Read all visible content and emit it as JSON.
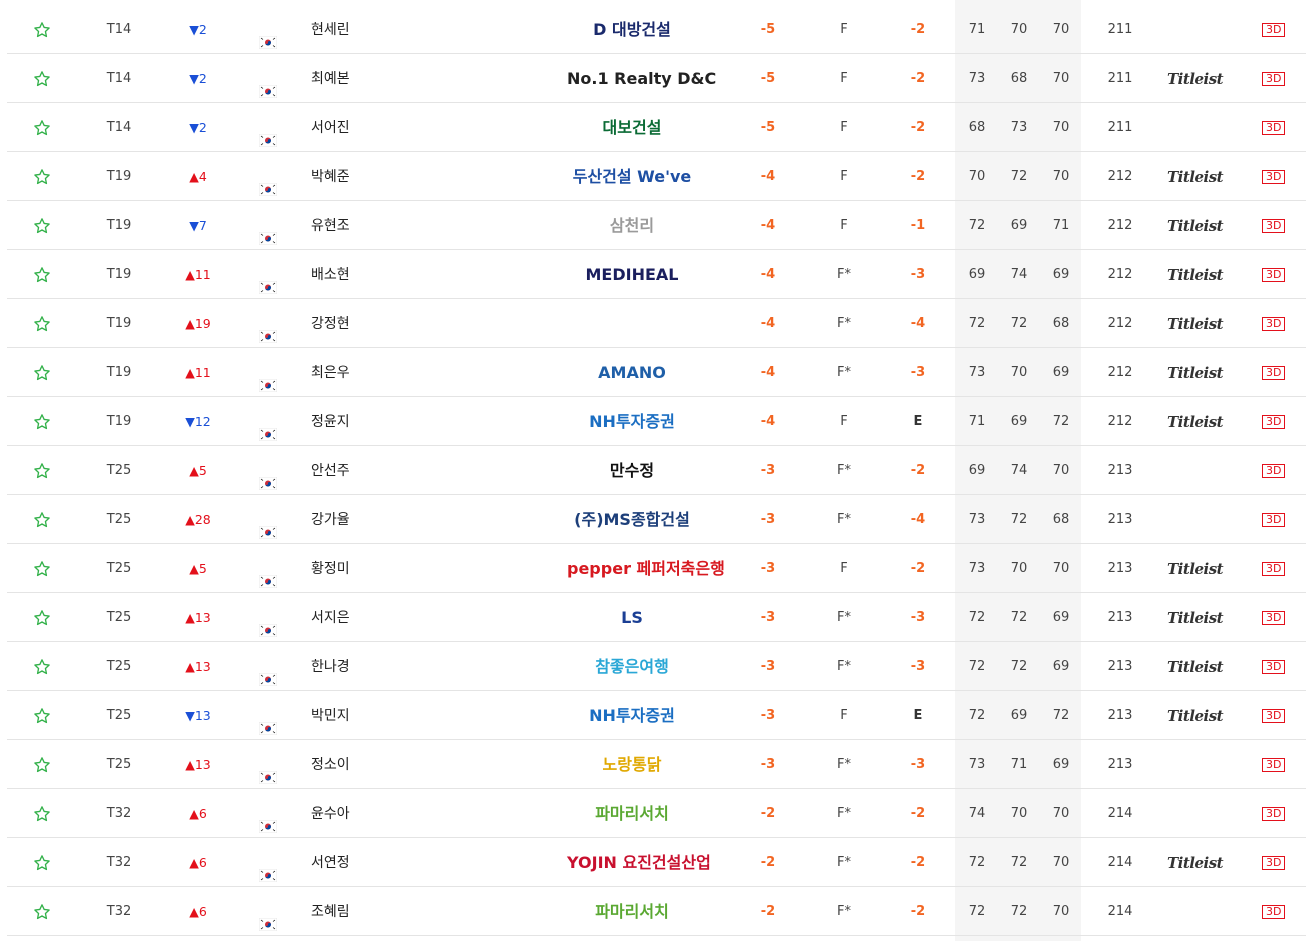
{
  "leaderboard": {
    "btn_label": "3D",
    "colors": {
      "accent_orange": "#f26522",
      "up_red": "#e3101b",
      "down_blue": "#1a4fd6",
      "star_green": "#33b14a"
    },
    "rows": [
      {
        "rank": "T14",
        "move": "▼2",
        "dir": "down",
        "name": "현세린",
        "sponsor": "D 대방건설",
        "sponsor_color": "#1a2a6c",
        "total": "-5",
        "thru": "F",
        "today": "-2",
        "r1": "71",
        "r2": "70",
        "r3": "70",
        "sum": "211",
        "club": ""
      },
      {
        "rank": "T14",
        "move": "▼2",
        "dir": "down",
        "name": "최예본",
        "sponsor": "No.1 Realty D&C",
        "sponsor_color": "#222222",
        "total": "-5",
        "thru": "F",
        "today": "-2",
        "r1": "73",
        "r2": "68",
        "r3": "70",
        "sum": "211",
        "club": "Titleist"
      },
      {
        "rank": "T14",
        "move": "▼2",
        "dir": "down",
        "name": "서어진",
        "sponsor": "대보건설",
        "sponsor_color": "#0b6b35",
        "total": "-5",
        "thru": "F",
        "today": "-2",
        "r1": "68",
        "r2": "73",
        "r3": "70",
        "sum": "211",
        "club": ""
      },
      {
        "rank": "T19",
        "move": "▲4",
        "dir": "up",
        "name": "박혜준",
        "sponsor": "두산건설 We've",
        "sponsor_color": "#1e4fa3",
        "total": "-4",
        "thru": "F",
        "today": "-2",
        "r1": "70",
        "r2": "72",
        "r3": "70",
        "sum": "212",
        "club": "Titleist"
      },
      {
        "rank": "T19",
        "move": "▼7",
        "dir": "down",
        "name": "유현조",
        "sponsor": "삼천리",
        "sponsor_color": "#9a9a9a",
        "total": "-4",
        "thru": "F",
        "today": "-1",
        "r1": "72",
        "r2": "69",
        "r3": "71",
        "sum": "212",
        "club": "Titleist"
      },
      {
        "rank": "T19",
        "move": "▲11",
        "dir": "up",
        "name": "배소현",
        "sponsor": "MEDIHEAL",
        "sponsor_color": "#1b1f5e",
        "total": "-4",
        "thru": "F*",
        "today": "-3",
        "r1": "69",
        "r2": "74",
        "r3": "69",
        "sum": "212",
        "club": "Titleist"
      },
      {
        "rank": "T19",
        "move": "▲19",
        "dir": "up",
        "name": "강정현",
        "sponsor": "",
        "sponsor_color": "#222222",
        "total": "-4",
        "thru": "F*",
        "today": "-4",
        "r1": "72",
        "r2": "72",
        "r3": "68",
        "sum": "212",
        "club": "Titleist"
      },
      {
        "rank": "T19",
        "move": "▲11",
        "dir": "up",
        "name": "최은우",
        "sponsor": "AMANO",
        "sponsor_color": "#1f5fa8",
        "total": "-4",
        "thru": "F*",
        "today": "-3",
        "r1": "73",
        "r2": "70",
        "r3": "69",
        "sum": "212",
        "club": "Titleist"
      },
      {
        "rank": "T19",
        "move": "▼12",
        "dir": "down",
        "name": "정윤지",
        "sponsor": "NH투자증권",
        "sponsor_color": "#1b6ec2",
        "total": "-4",
        "thru": "F",
        "today": "E",
        "r1": "71",
        "r2": "69",
        "r3": "72",
        "sum": "212",
        "club": "Titleist"
      },
      {
        "rank": "T25",
        "move": "▲5",
        "dir": "up",
        "name": "안선주",
        "sponsor": "만수정",
        "sponsor_color": "#111111",
        "total": "-3",
        "thru": "F*",
        "today": "-2",
        "r1": "69",
        "r2": "74",
        "r3": "70",
        "sum": "213",
        "club": ""
      },
      {
        "rank": "T25",
        "move": "▲28",
        "dir": "up",
        "name": "강가율",
        "sponsor": "(주)MS종합건설",
        "sponsor_color": "#1d3f7a",
        "total": "-3",
        "thru": "F*",
        "today": "-4",
        "r1": "73",
        "r2": "72",
        "r3": "68",
        "sum": "213",
        "club": ""
      },
      {
        "rank": "T25",
        "move": "▲5",
        "dir": "up",
        "name": "황정미",
        "sponsor": "pepper 페퍼저축은행",
        "sponsor_color": "#d71920",
        "total": "-3",
        "thru": "F",
        "today": "-2",
        "r1": "73",
        "r2": "70",
        "r3": "70",
        "sum": "213",
        "club": "Titleist"
      },
      {
        "rank": "T25",
        "move": "▲13",
        "dir": "up",
        "name": "서지은",
        "sponsor": "LS",
        "sponsor_color": "#1b3f94",
        "total": "-3",
        "thru": "F*",
        "today": "-3",
        "r1": "72",
        "r2": "72",
        "r3": "69",
        "sum": "213",
        "club": "Titleist"
      },
      {
        "rank": "T25",
        "move": "▲13",
        "dir": "up",
        "name": "한나경",
        "sponsor": "참좋은여행",
        "sponsor_color": "#2aa7d6",
        "total": "-3",
        "thru": "F*",
        "today": "-3",
        "r1": "72",
        "r2": "72",
        "r3": "69",
        "sum": "213",
        "club": "Titleist"
      },
      {
        "rank": "T25",
        "move": "▼13",
        "dir": "down",
        "name": "박민지",
        "sponsor": "NH투자증권",
        "sponsor_color": "#1b6ec2",
        "total": "-3",
        "thru": "F",
        "today": "E",
        "r1": "72",
        "r2": "69",
        "r3": "72",
        "sum": "213",
        "club": "Titleist"
      },
      {
        "rank": "T25",
        "move": "▲13",
        "dir": "up",
        "name": "정소이",
        "sponsor": "노랑통닭",
        "sponsor_color": "#e0a800",
        "total": "-3",
        "thru": "F*",
        "today": "-3",
        "r1": "73",
        "r2": "71",
        "r3": "69",
        "sum": "213",
        "club": ""
      },
      {
        "rank": "T32",
        "move": "▲6",
        "dir": "up",
        "name": "윤수아",
        "sponsor": "파마리서치",
        "sponsor_color": "#5aa832",
        "total": "-2",
        "thru": "F*",
        "today": "-2",
        "r1": "74",
        "r2": "70",
        "r3": "70",
        "sum": "214",
        "club": ""
      },
      {
        "rank": "T32",
        "move": "▲6",
        "dir": "up",
        "name": "서연정",
        "sponsor": "YOJIN 요진건설산업",
        "sponsor_color": "#c8102e",
        "total": "-2",
        "thru": "F*",
        "today": "-2",
        "r1": "72",
        "r2": "72",
        "r3": "70",
        "sum": "214",
        "club": "Titleist"
      },
      {
        "rank": "T32",
        "move": "▲6",
        "dir": "up",
        "name": "조혜림",
        "sponsor": "파마리서치",
        "sponsor_color": "#5aa832",
        "total": "-2",
        "thru": "F*",
        "today": "-2",
        "r1": "72",
        "r2": "72",
        "r3": "70",
        "sum": "214",
        "club": ""
      }
    ]
  }
}
